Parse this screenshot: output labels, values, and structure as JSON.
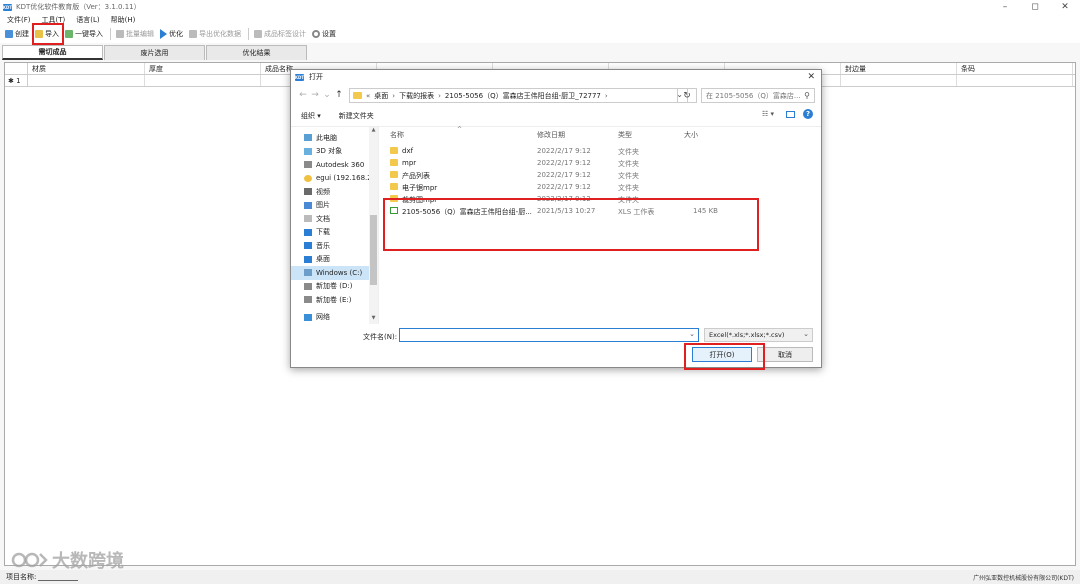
{
  "app": {
    "title": "KDT优化软件教育版（Ver：3.1.0.11）",
    "logo_text": "KDT"
  },
  "menu": [
    "文件(F)",
    "工具(T)",
    "语言(L)",
    "帮助(H)"
  ],
  "toolbar": {
    "new_label": "创建",
    "import_label": "导入",
    "one_click_import_label": "一键导入",
    "batch_edit_label": "批量编辑",
    "optimize_label": "优化",
    "export_optimize_label": "导出优化数据",
    "label_design_label": "成品标签设计",
    "settings_label": "设置"
  },
  "tabs": [
    "需切成品",
    "废片选用",
    "优化结果"
  ],
  "grid": {
    "columns": [
      "材质",
      "厚度",
      "成品名称",
      "",
      "",
      "",
      "",
      "封边量",
      "条码"
    ],
    "row_indicator": "✱ 1"
  },
  "status": {
    "project_label": "项目名称:",
    "company": "广州弘亚数控机械股份有限公司(KDT)"
  },
  "watermark": "大数跨境",
  "dialog": {
    "logo_text": "KDT",
    "title": "打开",
    "address": {
      "prefix": "«",
      "parts": [
        "桌面",
        "下载的报表",
        "2105-5056（Q）富森店王伟阳台组-厨卫_72777"
      ]
    },
    "search_placeholder": "在 2105-5056（Q）富森店...",
    "organize_label": "组织 ▾",
    "new_folder_label": "新建文件夹",
    "nav_items": [
      {
        "label": "此电脑",
        "icon": "pc-icon"
      },
      {
        "label": "3D 对象",
        "icon": "3d-objects-icon"
      },
      {
        "label": "Autodesk 360",
        "icon": "cloud-drive-icon"
      },
      {
        "label": "egui (192.168.2",
        "icon": "network-user-icon"
      },
      {
        "label": "视频",
        "icon": "video-icon"
      },
      {
        "label": "图片",
        "icon": "pictures-icon"
      },
      {
        "label": "文档",
        "icon": "documents-icon"
      },
      {
        "label": "下载",
        "icon": "downloads-icon"
      },
      {
        "label": "音乐",
        "icon": "music-icon"
      },
      {
        "label": "桌面",
        "icon": "desktop-icon"
      },
      {
        "label": "Windows (C:)",
        "icon": "windows-drive-icon"
      },
      {
        "label": "新加卷 (D:)",
        "icon": "drive-d-icon"
      },
      {
        "label": "新加卷 (E:)",
        "icon": "drive-e-icon"
      },
      {
        "label": "网络",
        "icon": "network-icon"
      }
    ],
    "columns": {
      "name": "名称",
      "date": "修改日期",
      "type": "类型",
      "size": "大小"
    },
    "files": [
      {
        "name": "dxf",
        "date": "2022/2/17 9:12",
        "type": "文件夹",
        "size": "",
        "kind": "folder"
      },
      {
        "name": "mpr",
        "date": "2022/2/17 9:12",
        "type": "文件夹",
        "size": "",
        "kind": "folder"
      },
      {
        "name": "产品列表",
        "date": "2022/2/17 9:12",
        "type": "文件夹",
        "size": "",
        "kind": "folder"
      },
      {
        "name": "电子锯mpr",
        "date": "2022/2/17 9:12",
        "type": "文件夹",
        "size": "",
        "kind": "folder"
      },
      {
        "name": "裁剪图mpr",
        "date": "2022/2/17 9:12",
        "type": "文件夹",
        "size": "",
        "kind": "folder"
      },
      {
        "name": "2105-5056（Q）富森店王伟阳台组-厨...",
        "date": "2021/5/13 10:27",
        "type": "XLS 工作表",
        "size": "145 KB",
        "kind": "xls"
      }
    ],
    "filename_label": "文件名(N):",
    "filename_value": "",
    "filetype_value": "Excel(*.xls;*.xlsx;*.csv)",
    "open_label": "打开(O)",
    "cancel_label": "取消"
  },
  "colors": {
    "highlight": "#e02020",
    "accent": "#2a7fd4",
    "selected_nav": "#cce4f7"
  }
}
